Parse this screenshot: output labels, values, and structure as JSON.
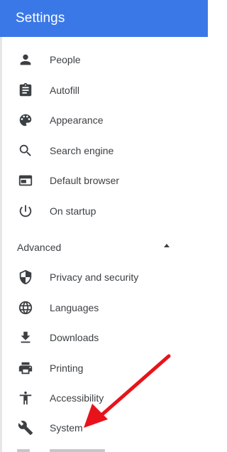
{
  "header": {
    "title": "Settings"
  },
  "sections": {
    "basic": [
      {
        "label": "People",
        "icon": "person-icon"
      },
      {
        "label": "Autofill",
        "icon": "clipboard-icon"
      },
      {
        "label": "Appearance",
        "icon": "palette-icon"
      },
      {
        "label": "Search engine",
        "icon": "search-icon"
      },
      {
        "label": "Default browser",
        "icon": "browser-window-icon"
      },
      {
        "label": "On startup",
        "icon": "power-icon"
      }
    ],
    "advanced": {
      "label": "Advanced",
      "items": [
        {
          "label": "Privacy and security",
          "icon": "shield-icon"
        },
        {
          "label": "Languages",
          "icon": "globe-icon"
        },
        {
          "label": "Downloads",
          "icon": "download-icon"
        },
        {
          "label": "Printing",
          "icon": "printer-icon"
        },
        {
          "label": "Accessibility",
          "icon": "accessibility-icon"
        },
        {
          "label": "System",
          "icon": "wrench-icon"
        }
      ]
    }
  },
  "colors": {
    "header_bg": "#3b78e7",
    "text": "#3c4043",
    "annotation_arrow": "#e8131a"
  }
}
